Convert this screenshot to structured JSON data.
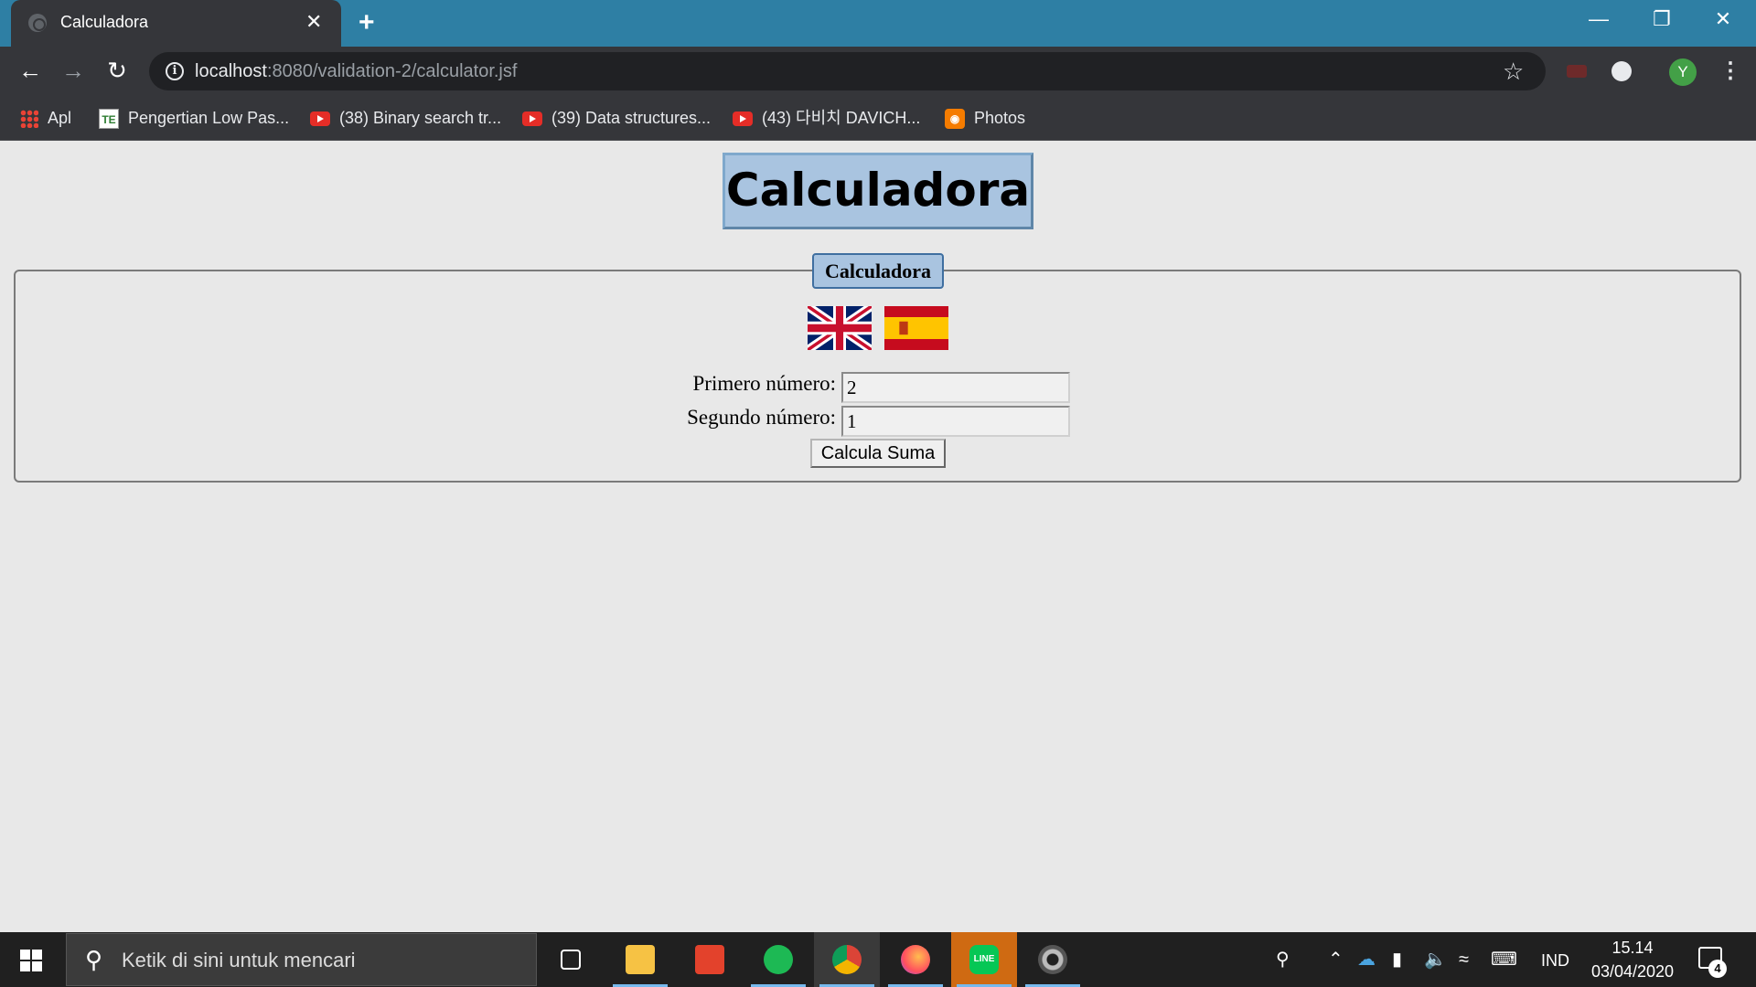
{
  "browser": {
    "tab_title": "Calculadora",
    "tab_close": "✕",
    "new_tab": "+",
    "url_host": "localhost",
    "url_rest": ":8080/validation-2/calculator.jsf",
    "profile_initial": "Y"
  },
  "bookmarks": [
    {
      "label": "Apl",
      "icon": "apps-icon"
    },
    {
      "label": "Pengertian Low Pas...",
      "icon": "te-icon"
    },
    {
      "label": "(38) Binary search tr...",
      "icon": "youtube-icon"
    },
    {
      "label": "(39) Data structures...",
      "icon": "youtube-icon"
    },
    {
      "label": "(43) 다비치 DAVICH...",
      "icon": "youtube-icon"
    },
    {
      "label": "Photos",
      "icon": "photos-icon"
    }
  ],
  "page": {
    "title": "Calculadora",
    "legend": "Calculadora",
    "first_label": "Primero número:",
    "first_value": "2",
    "second_label": "Segundo número:",
    "second_value": "1",
    "button_label": "Calcula Suma",
    "flags": [
      "uk-flag",
      "spain-flag"
    ]
  },
  "taskbar": {
    "search_placeholder": "Ketik di sini untuk mencari",
    "language": "IND",
    "time": "15.14",
    "date": "03/04/2020",
    "notification_count": "4"
  }
}
